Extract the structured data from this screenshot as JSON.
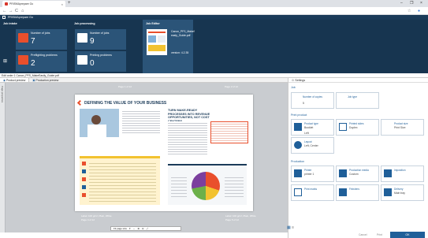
{
  "browser": {
    "tab_title": "PRISMAprepare Go",
    "tab_close": "×",
    "new_tab": "+",
    "nav": {
      "back": "←",
      "forward": "→",
      "reload": "C",
      "home": "⌂"
    },
    "window_controls": {
      "minimize": "–",
      "restore": "❐",
      "close": "×"
    }
  },
  "app": {
    "name": "PRISMAprepare Go"
  },
  "dashboard": {
    "job_intake": {
      "header": "Job intake",
      "tiles": [
        {
          "label": "Number of jobs",
          "value": "7"
        },
        {
          "label": "Preflighting problems",
          "value": "2"
        }
      ]
    },
    "job_processing": {
      "header": "Job processing",
      "tiles": [
        {
          "label": "Number of jobs",
          "value": "9"
        },
        {
          "label": "Printing problems",
          "value": "0"
        }
      ]
    },
    "job_editor": {
      "header": "Job Editor",
      "file_name": "Canon_PFS_Makef easly_Guide.pdf",
      "version": "version: 4.2.35"
    }
  },
  "editor": {
    "title": "Edit order 1 Canon_PFS_MakeEasily_Guide.pdf",
    "tabs": [
      {
        "label": "Product preview",
        "active": true
      },
      {
        "label": "Production preview",
        "active": false
      }
    ],
    "left_strip": "Page properties",
    "page_label_left": "Page 1 of 12",
    "page_label_right": "Page 2 of 12",
    "spread": {
      "left_heading": "DEFINING THE VALUE OF YOUR BUSINESS",
      "right_heading": "TURN MAKE-READY PROCESSES INTO REVENUE OPPORTUNITIES, NOT COST CENTERS"
    },
    "media_left": "Label: 100 g/m², Plain, White",
    "media_left_page": "Page 4 of 12",
    "media_right": "Label: 100 g/m², Plain, White",
    "media_right_page": "Page 5 of 12",
    "zoom": {
      "label": "Fit page size"
    }
  },
  "settings": {
    "header": "Settings",
    "sections": {
      "job": "Job",
      "print_product": "Print product",
      "production": "Production"
    },
    "job_cards": [
      {
        "label": "Number of copies",
        "value": "5"
      },
      {
        "label": "Job type",
        "value": ""
      }
    ],
    "product_cards": [
      {
        "label": "Product type",
        "value": "Booklet",
        "value2": "Left"
      },
      {
        "label": "Printed sides",
        "value": "Duplex"
      },
      {
        "label": "Product size",
        "value": "Print Size"
      },
      {
        "label": "Layout",
        "value": "Left, Center"
      }
    ],
    "production_cards": [
      {
        "label": "Printer",
        "value": "printer 1"
      },
      {
        "label": "Production media",
        "value": "Custom"
      },
      {
        "label": "Imposition",
        "value": ""
      },
      {
        "label": "Print marks",
        "value": ""
      },
      {
        "label": "Finishers",
        "value": ""
      },
      {
        "label": "Delivery",
        "value": "Main tray"
      }
    ],
    "buttons": {
      "cancel": "Cancel",
      "print": "Print",
      "ok": "OK"
    }
  }
}
